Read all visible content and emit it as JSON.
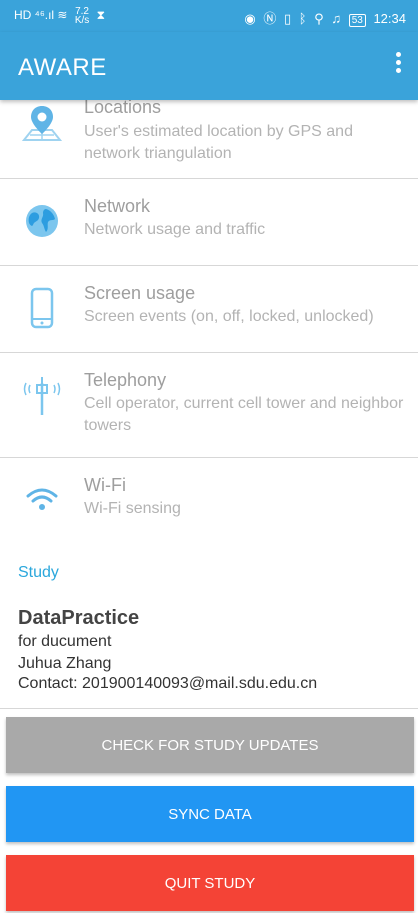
{
  "status_bar": {
    "left_icons": "HD ⁴⁶.ıl ≋",
    "speed_value": "7.2",
    "speed_unit": "K/s",
    "time": "12:34",
    "battery": "53"
  },
  "app_bar": {
    "title": "AWARE"
  },
  "sensors": [
    {
      "title": "Locations",
      "description": "User's estimated location by GPS and network triangulation"
    },
    {
      "title": "Network",
      "description": "Network usage and traffic"
    },
    {
      "title": "Screen usage",
      "description": "Screen events (on, off, locked, unlocked)"
    },
    {
      "title": "Telephony",
      "description": "Cell operator, current cell tower and neighbor towers"
    },
    {
      "title": "Wi-Fi",
      "description": "Wi-Fi sensing"
    }
  ],
  "study": {
    "header": "Study",
    "name": "DataPractice",
    "description": "for ducument",
    "owner": "Juhua Zhang",
    "contact": "Contact: 201900140093@mail.sdu.edu.cn"
  },
  "buttons": {
    "check_updates": "CHECK FOR STUDY UPDATES",
    "sync": "SYNC DATA",
    "quit": "QUIT STUDY"
  },
  "colors": {
    "primary": "#3aa3da",
    "accent": "#2aa7dc",
    "sync_button": "#2196f3",
    "quit_button": "#f44336",
    "check_button": "#a9a9a9"
  }
}
